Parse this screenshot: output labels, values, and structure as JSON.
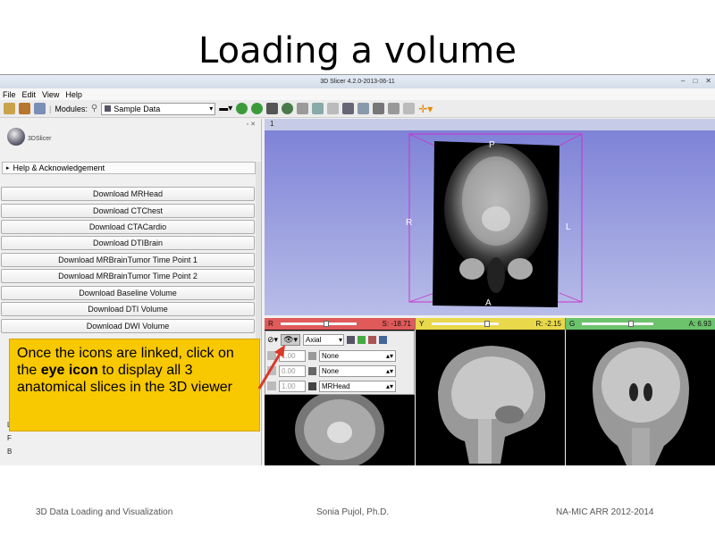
{
  "slide": {
    "title": "Loading a volume",
    "footer_left": "3D Data Loading and Visualization",
    "footer_center": "Sonia Pujol, Ph.D.",
    "footer_right": "NA-MIC ARR 2012-2014"
  },
  "window": {
    "title": "3D Slicer 4.2.0-2013-06-11",
    "controls": [
      "–",
      "□",
      "✕"
    ]
  },
  "menu": [
    "File",
    "Edit",
    "View",
    "Help"
  ],
  "toolbar": {
    "modules_label": "Modules:",
    "module_selected": "Sample Data"
  },
  "left_panel": {
    "logo_text": "3DSlicer",
    "help_section": "Help & Acknowledgement",
    "buttons": [
      "Download MRHead",
      "Download CTChest",
      "Download CTACardio",
      "Download DTIBrain",
      "Download MRBrainTumor Time Point 1",
      "Download MRBrainTumor Time Point 2",
      "Download Baseline Volume",
      "Download DTI Volume",
      "Download DWI Volume"
    ],
    "side_letters": [
      "L",
      "F",
      "B"
    ]
  },
  "view3d": {
    "layout_number": "1",
    "labels": {
      "P": "P",
      "A": "A",
      "R": "R",
      "L": "L"
    }
  },
  "slices": {
    "red": {
      "letter": "R",
      "value": "S: -18.71",
      "color": "#e05a5a"
    },
    "yellow": {
      "letter": "Y",
      "value": "R: -2.15",
      "color": "#e8d84a"
    },
    "green": {
      "letter": "G",
      "value": "A: 6.93",
      "color": "#6cc36c"
    }
  },
  "slice_controller": {
    "orientation": "Axial",
    "rows": [
      {
        "opacity": "1.00",
        "volume": "None"
      },
      {
        "opacity": "0.00",
        "volume": "None"
      },
      {
        "opacity": "1.00",
        "volume": "MRHead"
      }
    ]
  },
  "callout": {
    "text_before": "Once the icons are linked, click on the ",
    "text_bold": "eye icon",
    "text_after": " to display all 3 anatomical slices in the 3D viewer"
  },
  "colors": {
    "callout": "#f8c800",
    "arrow": "#d93a2a",
    "view_3d_bg": "#8e92dc",
    "bbox": "#cc33cc"
  }
}
